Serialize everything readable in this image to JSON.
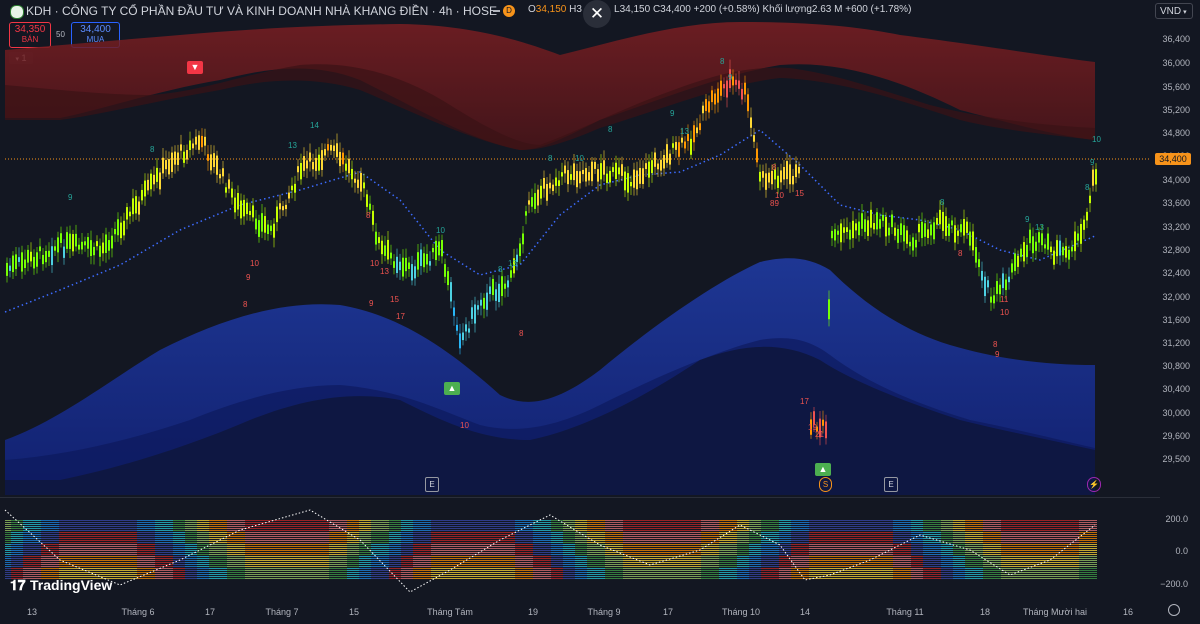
{
  "header": {
    "symbol_icon": "kdh-logo-icon",
    "title": "KDH · CÔNG TY CỔ PHẦN ĐẦU TƯ VÀ KINH DOANH NHÀ KHANG ĐIỀN · 4h · HOSE",
    "flag_label": "D",
    "open_label": "O",
    "open_value": "34,150",
    "high_label": "H3",
    "low_label": "L",
    "low_value": "34,150",
    "close_label": "C",
    "close_value": "34,400",
    "change": "+200 (+0.58%)",
    "volume_label": "Khối lượng",
    "volume_value": "2.63 M",
    "volume_change": "+600 (+1.78%)",
    "currency": "VND"
  },
  "trade": {
    "sell_price": "34,350",
    "sell_label": "BÁN",
    "spread": "50",
    "buy_price": "34,400",
    "buy_label": "MUA",
    "indicator_count": "1"
  },
  "price_axis": {
    "ticks": [
      "36,400",
      "36,000",
      "35,600",
      "35,200",
      "34,800",
      "34,400",
      "34,000",
      "33,600",
      "33,200",
      "32,800",
      "32,400",
      "32,000",
      "31,600",
      "31,200",
      "30,800",
      "30,400",
      "30,000",
      "29,600",
      "29,500"
    ],
    "last_price": "34,400"
  },
  "osc_axis": {
    "ticks": [
      "200.0",
      "0.0",
      "−200.0"
    ]
  },
  "time_axis": {
    "labels": [
      "13",
      "Tháng 6",
      "17",
      "Tháng 7",
      "15",
      "Tháng Tám",
      "19",
      "Tháng 9",
      "17",
      "Tháng 10",
      "14",
      "Tháng 11",
      "18",
      "Tháng Mười hai",
      "16"
    ]
  },
  "markers": {
    "events": [
      "E",
      "E"
    ],
    "split": "S",
    "lightning": "⚡",
    "sell_signal": "▼",
    "buy_signal": "▲"
  },
  "branding": {
    "logo_text": "TradingView"
  },
  "colors": {
    "background": "#131722",
    "up": "#26a69a",
    "down": "#ef5350",
    "last_price": "#f7931a"
  }
}
